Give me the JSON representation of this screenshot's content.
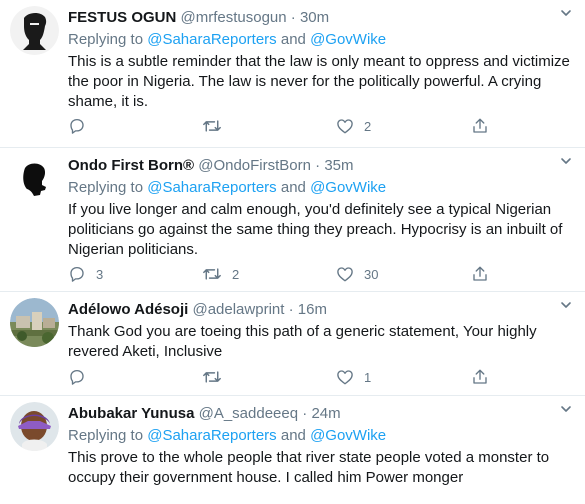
{
  "reply_prefix": "Replying to",
  "reply_and": "and",
  "tweets": [
    {
      "name": "FESTUS OGUN",
      "verified_glyph": "",
      "handle": "@mrfestusogun",
      "time": "30m",
      "reply_to": [
        "@SaharaReporters",
        "@GovWike"
      ],
      "text": "This is a subtle reminder that the law is only meant to oppress and victimize the poor in Nigeria. The law is never for the politically powerful. A crying shame, it is.",
      "counts": {
        "reply": "",
        "retweet": "",
        "like": "2"
      }
    },
    {
      "name": "Ondo First Born®",
      "handle": "@OndoFirstBorn",
      "time": "35m",
      "reply_to": [
        "@SaharaReporters",
        "@GovWike"
      ],
      "text": "If you live longer and calm enough, you'd definitely see a typical Nigerian politicians go against the same thing they preach. Hypocrisy is an inbuilt of Nigerian politicians.",
      "counts": {
        "reply": "3",
        "retweet": "2",
        "like": "30"
      }
    },
    {
      "name": "Adélowo Adésoji",
      "handle": "@adelawprint",
      "time": "16m",
      "text": "Thank  God you are toeing  this path of a generic statement, Your highly revered Aketi, Inclusive",
      "counts": {
        "reply": "",
        "retweet": "",
        "like": "1"
      }
    },
    {
      "name": "Abubakar Yunusa",
      "handle": "@A_saddeeeq",
      "time": "24m",
      "reply_to": [
        "@SaharaReporters",
        "@GovWike"
      ],
      "text": "This prove to the whole people that river state people voted a monster to occupy their government house. I called him Power monger"
    }
  ],
  "colors": {
    "link": "#1da1f2",
    "muted": "#657786",
    "text": "#14171a",
    "divider": "#e6ecf0"
  },
  "icons": {
    "reply": "reply-icon",
    "retweet": "retweet-icon",
    "like": "heart-icon",
    "share": "share-icon",
    "more": "chevron-down-icon"
  }
}
